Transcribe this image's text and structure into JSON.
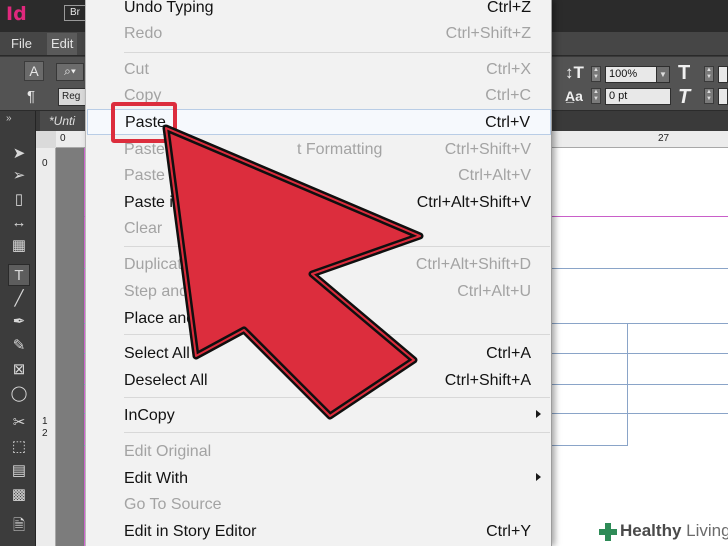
{
  "app": {
    "logo": "Id",
    "bridge": "Br",
    "menus": [
      "File",
      "Edit"
    ],
    "document_tab": "*Unti"
  },
  "control_panel": {
    "search_icon": "search-icon",
    "style_field": "Reg",
    "zoom_value": "100%",
    "baseline_value": "0 pt"
  },
  "ruler": {
    "top_marks": [
      "0",
      "27"
    ],
    "left_marks": [
      "0",
      "1",
      "2"
    ]
  },
  "edit_menu": {
    "items": [
      {
        "label": "Undo Typing",
        "shortcut": "Ctrl+Z",
        "enabled": true
      },
      {
        "label": "Redo",
        "shortcut": "Ctrl+Shift+Z",
        "enabled": false
      },
      {
        "label": "Cut",
        "shortcut": "Ctrl+X",
        "enabled": false
      },
      {
        "label": "Copy",
        "shortcut": "Ctrl+C",
        "enabled": false
      },
      {
        "label": "Paste",
        "shortcut": "Ctrl+V",
        "enabled": true,
        "highlighted": true
      },
      {
        "label": "Paste",
        "label_tail": "t Formatting",
        "shortcut": "Ctrl+Shift+V",
        "enabled": false
      },
      {
        "label": "Paste In",
        "shortcut": "Ctrl+Alt+V",
        "enabled": false
      },
      {
        "label": "Paste in F",
        "shortcut": "Ctrl+Alt+Shift+V",
        "enabled": true
      },
      {
        "label": "Clear",
        "shortcut": "",
        "enabled": false
      },
      {
        "label": "Duplicate",
        "shortcut": "Ctrl+Alt+Shift+D",
        "enabled": false
      },
      {
        "label": "Step and Rep",
        "shortcut": "Ctrl+Alt+U",
        "enabled": false
      },
      {
        "label": "Place and Link",
        "shortcut": "",
        "enabled": true
      },
      {
        "label": "Select All",
        "shortcut": "Ctrl+A",
        "enabled": true
      },
      {
        "label": "Deselect All",
        "shortcut": "Ctrl+Shift+A",
        "enabled": true
      },
      {
        "label": "InCopy",
        "shortcut": "",
        "enabled": true,
        "submenu": true
      },
      {
        "label": "Edit Original",
        "shortcut": "",
        "enabled": false
      },
      {
        "label": "Edit With",
        "shortcut": "",
        "enabled": true,
        "submenu": true
      },
      {
        "label": "Go To Source",
        "shortcut": "",
        "enabled": false
      },
      {
        "label": "Edit in Story Editor",
        "shortcut": "Ctrl+Y",
        "enabled": true
      }
    ]
  },
  "annotation": {
    "arrow_color": "#dc2d3d",
    "highlight_box_color": "#dc2d3d"
  },
  "watermark": {
    "brand_bold": "Healthy",
    "brand_light": " Living",
    "color": "#2e8b57"
  }
}
